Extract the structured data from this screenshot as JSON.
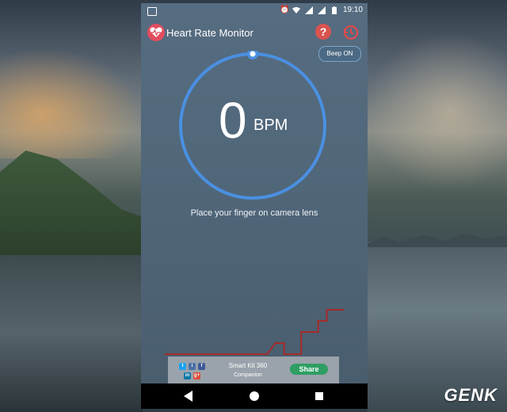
{
  "status_bar": {
    "time": "19:10",
    "icons": [
      "image-notification-icon",
      "alarm-icon",
      "wifi-icon",
      "signal-icon",
      "signal-icon",
      "battery-icon"
    ]
  },
  "app": {
    "title": "Heart Rate Monitor",
    "icons": {
      "app": "heart-logo-icon",
      "help": "help-icon",
      "history": "history-icon"
    }
  },
  "beep_toggle": {
    "label": "Beep ON"
  },
  "measurement": {
    "value": "0",
    "unit": "BPM",
    "instruction": "Place your finger on camera lens"
  },
  "chart_data": {
    "type": "line",
    "x": [
      0,
      1,
      2,
      3,
      4,
      5,
      6,
      7,
      8,
      9,
      10,
      11,
      12,
      13,
      14,
      15,
      16,
      17,
      18,
      19,
      20,
      21
    ],
    "series": [
      {
        "values": [
          0,
          0,
          0,
          0,
          0,
          0,
          0,
          0,
          0,
          0,
          0,
          0,
          0,
          1,
          0,
          0,
          2,
          2,
          3,
          4,
          4,
          4
        ]
      }
    ],
    "colors": [
      "#a52a2a"
    ]
  },
  "share_bar": {
    "social_icons": [
      "twitter-icon",
      "instagram-icon",
      "facebook-icon",
      "linkedin-icon",
      "googleplus-icon"
    ],
    "brand_line1": "Smart Kit 360",
    "brand_line2": "Companion",
    "share_label": "Share"
  },
  "nav_bar": {
    "icons": [
      "back-icon",
      "home-icon",
      "recents-icon"
    ]
  },
  "watermark": "GENK",
  "colors": {
    "gauge_ring": "#4a90e2",
    "graph_line": "#a52a2a",
    "share_button": "#2e9e63",
    "help_button": "#d9534f",
    "app_icon": "#e34c5f"
  }
}
